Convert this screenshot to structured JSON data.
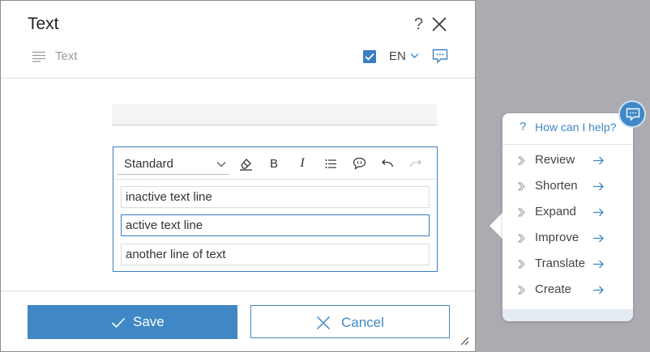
{
  "dialog": {
    "title": "Text",
    "help_glyph": "?",
    "subtitle": "Text",
    "language": "EN",
    "language_checked": true,
    "icons": {
      "close": "close-icon",
      "lines": "text-lines-icon",
      "language_toggle": "chevron-down-icon",
      "assistant": "chat-icon"
    }
  },
  "editor": {
    "style_value": "Standard",
    "toolbar_icons": [
      "eraser-icon",
      "bold-icon",
      "italic-icon",
      "list-icon",
      "comment-icon",
      "undo-icon",
      "redo-icon"
    ],
    "bold_glyph": "B",
    "italic_glyph": "I",
    "lines": [
      {
        "text": "inactive text line",
        "active": false
      },
      {
        "text": "active text line",
        "active": true
      },
      {
        "text": "another line of text",
        "active": false
      }
    ]
  },
  "footer": {
    "save_label": "Save",
    "cancel_label": "Cancel"
  },
  "assistant": {
    "header_glyph": "?",
    "header_label": "How can I help?",
    "items": [
      "Review",
      "Shorten",
      "Expand",
      "Improve",
      "Translate",
      "Create"
    ]
  },
  "colors": {
    "accent": "#3f88c5",
    "backdrop": "#acabb1",
    "panel_footer": "#e4ecf3"
  }
}
